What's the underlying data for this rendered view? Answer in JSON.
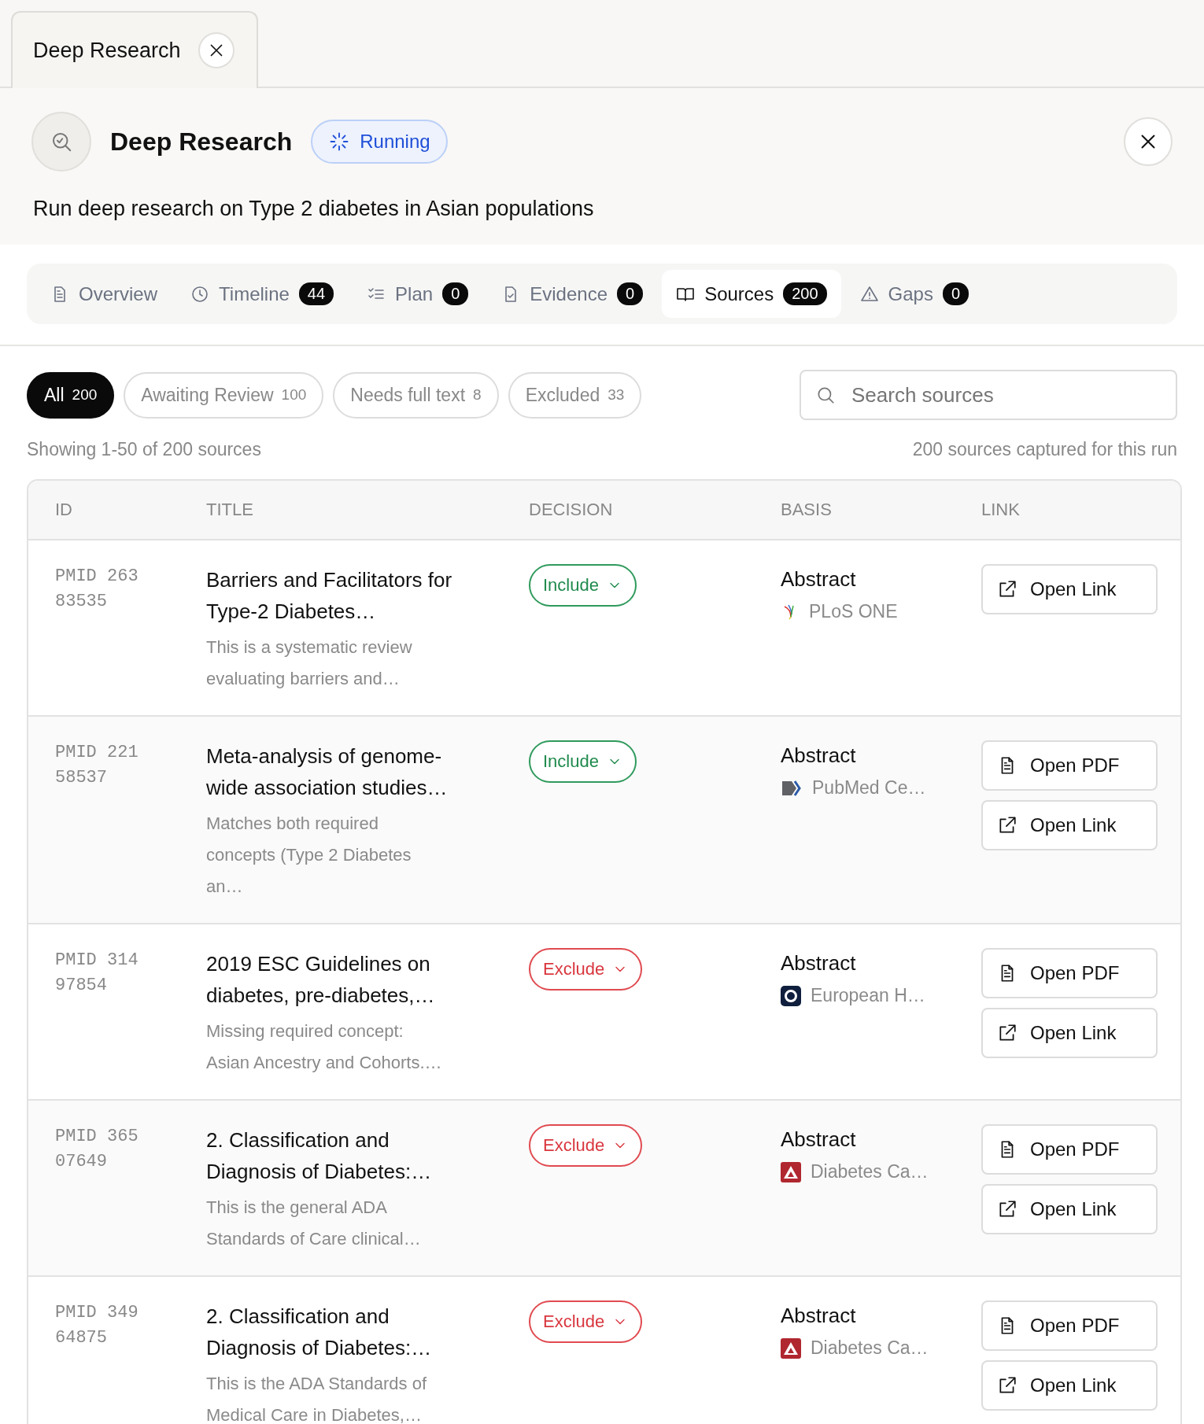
{
  "window_tab": {
    "title": "Deep Research"
  },
  "header": {
    "title": "Deep Research",
    "status": {
      "label": "Running",
      "kind": "running"
    },
    "description": "Run deep research on Type 2 diabetes in Asian populations"
  },
  "tabs": [
    {
      "label": "Overview",
      "selected": false
    },
    {
      "label": "Timeline",
      "count": "44",
      "selected": false
    },
    {
      "label": "Plan",
      "count": "0",
      "selected": false
    },
    {
      "label": "Evidence",
      "count": "0",
      "selected": false
    },
    {
      "label": "Sources",
      "count": "200",
      "selected": true
    },
    {
      "label": "Gaps",
      "count": "0",
      "selected": false
    }
  ],
  "filters": [
    {
      "label": "All",
      "count": "200",
      "selected": true
    },
    {
      "label": "Awaiting Review",
      "count": "100",
      "selected": false
    },
    {
      "label": "Needs full text",
      "count": "8",
      "selected": false
    },
    {
      "label": "Excluded",
      "count": "33",
      "selected": false
    }
  ],
  "search": {
    "placeholder": "Search sources"
  },
  "summary": {
    "showing": "Showing 1-50 of 200 sources",
    "captured": "200 sources captured for this run"
  },
  "table": {
    "columns": [
      "ID",
      "TITLE",
      "DECISION",
      "BASIS",
      "LINK"
    ],
    "rows": [
      {
        "id": "PMID 26383535",
        "title": "Barriers and Facilitators for Type-2 Diabetes…",
        "description": "This is a systematic review evaluating barriers and…",
        "decision": {
          "label": "Include",
          "kind": "include"
        },
        "basis": "Abstract",
        "source": {
          "name": "PLoS ONE",
          "kind": "sprig"
        },
        "links": [
          {
            "kind": "link",
            "label": "Open Link"
          }
        ]
      },
      {
        "id": "PMID 22158537",
        "title": "Meta-analysis of genome-wide association studies…",
        "description": "Matches both required concepts (Type 2 Diabetes an…",
        "decision": {
          "label": "Include",
          "kind": "include"
        },
        "basis": "Abstract",
        "source": {
          "name": "PubMed Ce…",
          "kind": "chevron"
        },
        "links": [
          {
            "kind": "pdf",
            "label": "Open PDF"
          },
          {
            "kind": "link",
            "label": "Open Link"
          }
        ]
      },
      {
        "id": "PMID 31497854",
        "title": "2019 ESC Guidelines on diabetes, pre-diabetes,…",
        "description": "Missing required concept: Asian Ancestry and Cohorts.…",
        "decision": {
          "label": "Exclude",
          "kind": "exclude"
        },
        "basis": "Abstract",
        "source": {
          "name": "European H…",
          "kind": "ring"
        },
        "links": [
          {
            "kind": "pdf",
            "label": "Open PDF"
          },
          {
            "kind": "link",
            "label": "Open Link"
          }
        ]
      },
      {
        "id": "PMID 36507649",
        "title": "2. Classification and Diagnosis of Diabetes:…",
        "description": "This is the general ADA Standards of Care clinical…",
        "decision": {
          "label": "Exclude",
          "kind": "exclude"
        },
        "basis": "Abstract",
        "source": {
          "name": "Diabetes Ca…",
          "kind": "triangle"
        },
        "links": [
          {
            "kind": "pdf",
            "label": "Open PDF"
          },
          {
            "kind": "link",
            "label": "Open Link"
          }
        ]
      },
      {
        "id": "PMID 34964875",
        "title": "2. Classification and Diagnosis of Diabetes:…",
        "description": "This is the ADA Standards of Medical Care in Diabetes,…",
        "decision": {
          "label": "Exclude",
          "kind": "exclude"
        },
        "basis": "Abstract",
        "source": {
          "name": "Diabetes Ca…",
          "kind": "triangle"
        },
        "links": [
          {
            "kind": "pdf",
            "label": "Open PDF"
          },
          {
            "kind": "link",
            "label": "Open Link"
          }
        ]
      }
    ]
  }
}
